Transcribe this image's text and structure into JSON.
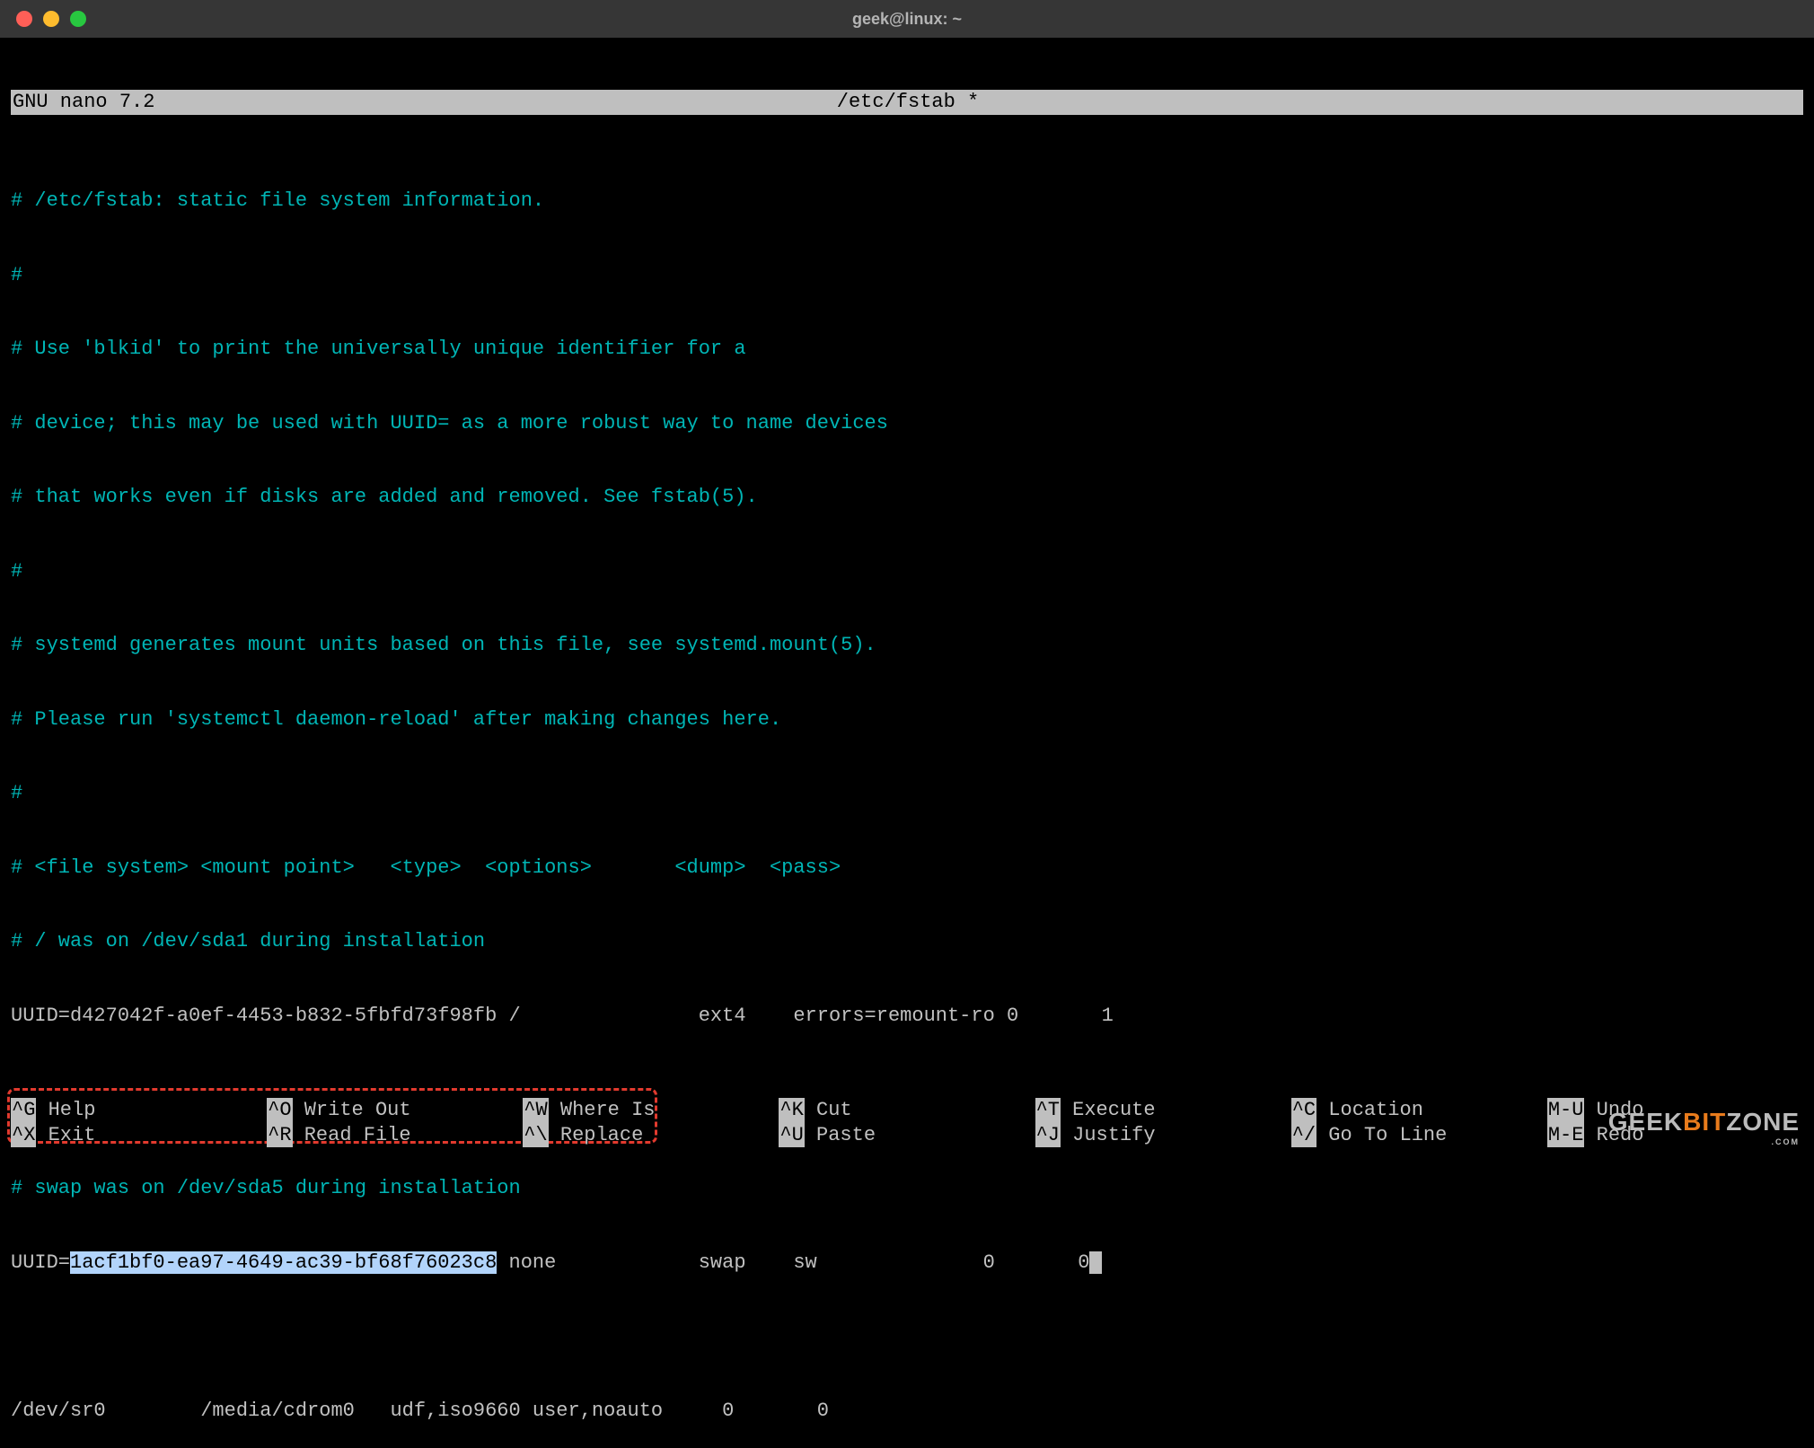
{
  "window": {
    "title": "geek@linux: ~"
  },
  "nano": {
    "app": "GNU nano 7.2",
    "file": "/etc/fstab *"
  },
  "content": {
    "l1": "# /etc/fstab: static file system information.",
    "l2": "#",
    "l3": "# Use 'blkid' to print the universally unique identifier for a",
    "l4": "# device; this may be used with UUID= as a more robust way to name devices",
    "l5": "# that works even if disks are added and removed. See fstab(5).",
    "l6": "#",
    "l7": "# systemd generates mount units based on this file, see systemd.mount(5).",
    "l8": "# Please run 'systemctl daemon-reload' after making changes here.",
    "l9": "#",
    "l10": "# <file system> <mount point>   <type>  <options>       <dump>  <pass>",
    "l11": "# / was on /dev/sda1 during installation",
    "l12": "UUID=d427042f-a0ef-4453-b832-5fbfd73f98fb /               ext4    errors=remount-ro 0       1",
    "l13": "# swap was on /dev/sda5 during installation",
    "l14_pre": "UUID=",
    "l14_sel": "1acf1bf0-ea97-4649-ac39-bf68f76023c8",
    "l14_post": " none            swap    sw              0       0",
    "l15": "/dev/sr0        /media/cdrom0   udf,iso9660 user,noauto     0       0"
  },
  "shortcuts": {
    "row1": [
      {
        "key": "^G",
        "label": "Help"
      },
      {
        "key": "^O",
        "label": "Write Out"
      },
      {
        "key": "^W",
        "label": "Where Is"
      },
      {
        "key": "^K",
        "label": "Cut"
      },
      {
        "key": "^T",
        "label": "Execute"
      },
      {
        "key": "^C",
        "label": "Location"
      },
      {
        "key": "M-U",
        "label": "Undo"
      }
    ],
    "row2": [
      {
        "key": "^X",
        "label": "Exit"
      },
      {
        "key": "^R",
        "label": "Read File"
      },
      {
        "key": "^\\",
        "label": "Replace"
      },
      {
        "key": "^U",
        "label": "Paste"
      },
      {
        "key": "^J",
        "label": "Justify"
      },
      {
        "key": "^/",
        "label": "Go To Line"
      },
      {
        "key": "M-E",
        "label": "Redo"
      }
    ]
  },
  "watermark": {
    "a": "GEEK",
    "b": "BIT",
    "c": "ZONE",
    "d": ".COM"
  }
}
